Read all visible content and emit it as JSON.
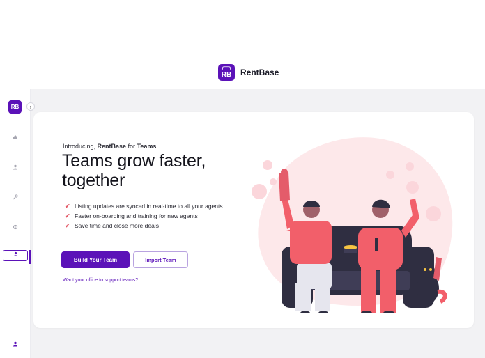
{
  "brand": {
    "logo_text": "RB",
    "name": "RentBase",
    "color": "#5b12b8"
  },
  "sidebar": {
    "logo_text": "RB",
    "expand_icon": "chevron-right-icon",
    "items": [
      {
        "icon": "home-icon"
      },
      {
        "icon": "user-icon"
      },
      {
        "icon": "key-icon"
      },
      {
        "icon": "settings-icon"
      },
      {
        "icon": "team-icon",
        "active": true
      }
    ],
    "bottom_icon": "profile-icon"
  },
  "hero": {
    "intro_prefix": "Introducing, ",
    "intro_brand": "RentBase",
    "intro_middle": " for ",
    "intro_suffix": "Teams",
    "headline_line1": "Teams grow faster,",
    "headline_line2": "together",
    "bullets": [
      "Listing updates are synced in real-time to all your agents",
      "Faster on-boarding and training for new agents",
      "Save time and close more deals"
    ],
    "primary_button": "Build Your Team",
    "secondary_button": "Import Team",
    "office_link": "Want your office to support teams?",
    "accent_color": "#e45c6a"
  }
}
